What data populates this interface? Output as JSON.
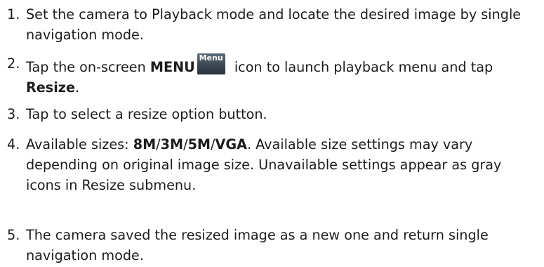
{
  "steps": [
    {
      "number": "1.",
      "text": "Set the camera to Playback mode and locate the desired image by single navigation mode."
    },
    {
      "number": "2.",
      "pre": "Tap the on-screen ",
      "bold1": "MENU",
      "icon_label": "Menu",
      "post": " icon to launch playback menu and tap ",
      "bold2": "Resize",
      "end": "."
    },
    {
      "number": "3.",
      "text": "Tap to select a resize option button."
    },
    {
      "number": "4.",
      "pre": "Available sizes: ",
      "sizes": [
        "8M",
        "3M",
        "5M",
        "VGA"
      ],
      "sep": "/",
      "post": ".  Available size settings may vary depending on original image size.  Unavailable settings appear as gray icons in Resize submenu."
    },
    {
      "number": "5.",
      "text": "The camera saved the resized image as a new one and return single navigation mode."
    }
  ]
}
